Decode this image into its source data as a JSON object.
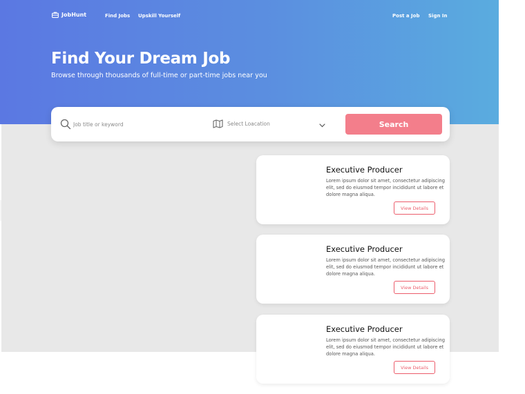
{
  "nav": {
    "brand": "JobHunt",
    "links": [
      "Find Jobs",
      "Upskill Yourself"
    ],
    "post_job": "Post a Job",
    "sign_in": "Sign In"
  },
  "hero": {
    "title": "Find Your Dream Job",
    "subtitle": "Browse through thousands of full-time or part-time jobs near you"
  },
  "search": {
    "keyword_placeholder": "Job title or keyword",
    "location_placeholder": "Select Loacation",
    "button_label": "Search",
    "button_color": "#f37e8b"
  },
  "jobs": [
    {
      "title": "Executive Producer",
      "description": "Lorem ipsum dolor sit amet, consectetur adipiscing elit, sed do eiusmod tempor incididunt ut labore et dolore magna aliqua.",
      "action": "View Details"
    },
    {
      "title": "Executive Producer",
      "description": "Lorem ipsum dolor sit amet, consectetur adipiscing elit, sed do eiusmod tempor incididunt ut labore et dolore magna aliqua.",
      "action": "View Details"
    },
    {
      "title": "Executive Producer",
      "description": "Lorem ipsum dolor sit amet, consectetur adipiscing elit, sed do eiusmod tempor incididunt ut labore et dolore magna aliqua.",
      "action": "View Details"
    }
  ],
  "colors": {
    "hero_start": "#5b78e2",
    "hero_end": "#5aacdf",
    "accent": "#ec5c6b"
  },
  "icons": [
    "briefcase-icon",
    "search-icon",
    "map-icon",
    "chevron-down-icon"
  ]
}
